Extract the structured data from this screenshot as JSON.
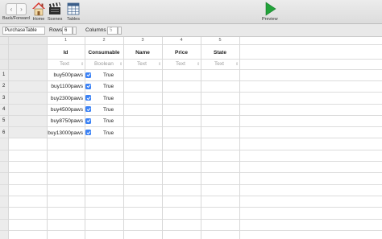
{
  "toolbar": {
    "back_forward_label": "Back/Forward",
    "home_label": "Home",
    "scenes_label": "Scenes",
    "tables_label": "Tables",
    "preview_label": "Preview"
  },
  "subbar": {
    "table_name": "PurchaseTable",
    "rows_label": "Rows",
    "rows_value": "6",
    "columns_label": "Columns",
    "columns_value": "5"
  },
  "table": {
    "column_numbers": [
      "1",
      "2",
      "3",
      "4",
      "5"
    ],
    "headers": [
      "Id",
      "Consumable",
      "Name",
      "Price",
      "State"
    ],
    "types": [
      "Text",
      "Boolean",
      "Text",
      "Text",
      "Text"
    ],
    "rows": [
      {
        "num": "1",
        "id": "buy500paws",
        "consumable": "True"
      },
      {
        "num": "2",
        "id": "buy1100paws",
        "consumable": "True"
      },
      {
        "num": "3",
        "id": "buy2300paws",
        "consumable": "True"
      },
      {
        "num": "4",
        "id": "buy4500paws",
        "consumable": "True"
      },
      {
        "num": "5",
        "id": "buy8750paws",
        "consumable": "True"
      },
      {
        "num": "6",
        "id": "buy13000paws",
        "consumable": "True"
      }
    ]
  },
  "colors": {
    "checkbox": "#3b82f6",
    "preview_play": "#22a33a",
    "home_roof": "#d9342b"
  }
}
